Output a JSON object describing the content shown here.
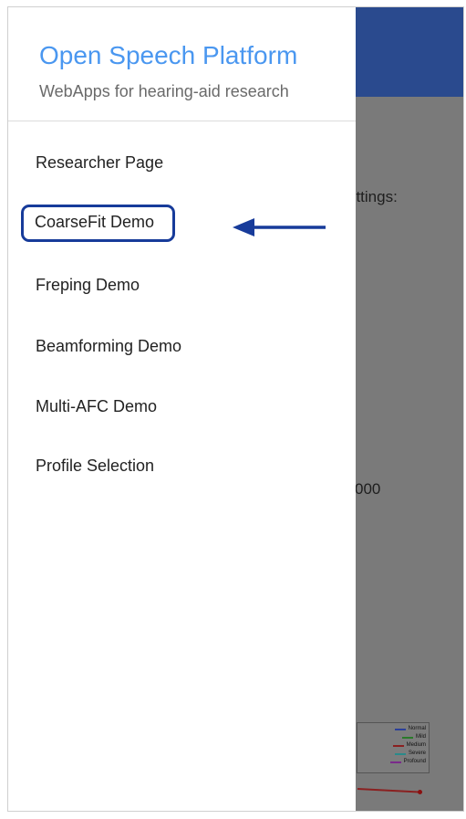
{
  "drawer": {
    "title": "Open Speech Platform",
    "subtitle": "WebApps for hearing-aid research",
    "items": [
      {
        "label": "Researcher Page"
      },
      {
        "label": "CoarseFit Demo",
        "highlighted": true
      },
      {
        "label": "Freping Demo"
      },
      {
        "label": "Beamforming Demo"
      },
      {
        "label": "Multi-AFC Demo"
      },
      {
        "label": "Profile Selection"
      }
    ]
  },
  "background": {
    "settings_fragment": "ettings:",
    "number_fragment": "000",
    "legend": [
      "Normal",
      "Mild",
      "Medium",
      "Severe",
      "Profound"
    ]
  },
  "colors": {
    "app_bar": "#2a4a8e",
    "title": "#4a97f0",
    "highlight_border": "#173b9a",
    "arrow": "#173b9a"
  },
  "annotation": {
    "arrow_icon": "left-arrow-icon"
  }
}
